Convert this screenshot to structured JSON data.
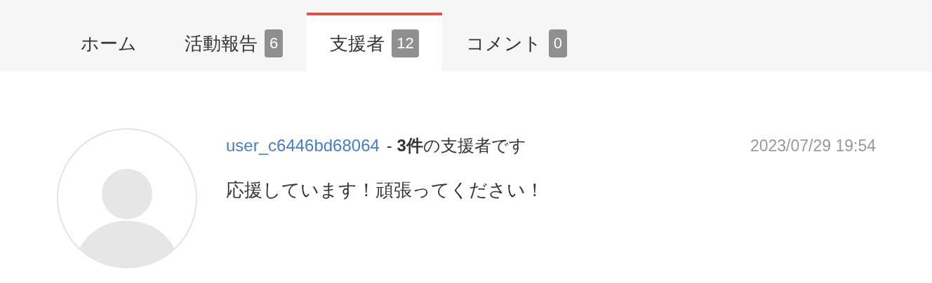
{
  "tabs": [
    {
      "label": "ホーム",
      "selected": false
    },
    {
      "label": "活動報告",
      "count": "6",
      "selected": false
    },
    {
      "label": "支援者",
      "count": "12",
      "selected": true
    },
    {
      "label": "コメント",
      "count": "0",
      "selected": false
    }
  ],
  "supporters": [
    {
      "user": "user_c6446bd68064",
      "summary": "- **3件**の支援者です",
      "date": "2023/07/29 19:54",
      "message": "応援しています！頑張ってください！"
    }
  ]
}
